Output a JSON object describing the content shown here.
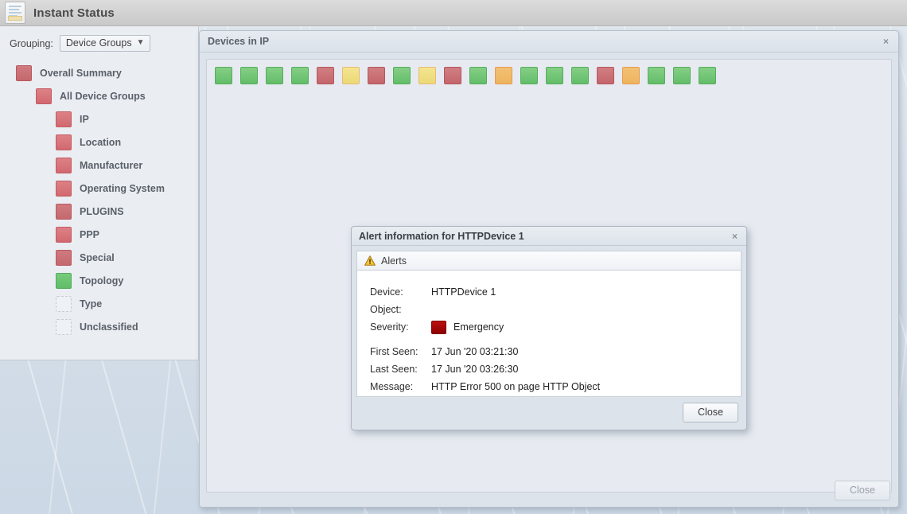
{
  "app": {
    "title": "Instant Status",
    "icon": "document-icon"
  },
  "sidebar": {
    "grouping_label": "Grouping:",
    "grouping_value": "Device Groups",
    "grouping_chevron": "⌄",
    "items": [
      {
        "label": "Overall Summary",
        "status": "red",
        "indent": 0
      },
      {
        "label": "All Device Groups",
        "status": "red2",
        "indent": 1
      },
      {
        "label": "IP",
        "status": "red2",
        "indent": 2
      },
      {
        "label": "Location",
        "status": "red2",
        "indent": 2
      },
      {
        "label": "Manufacturer",
        "status": "red2",
        "indent": 2
      },
      {
        "label": "Operating System",
        "status": "red2",
        "indent": 2
      },
      {
        "label": "PLUGINS",
        "status": "red",
        "indent": 2
      },
      {
        "label": "PPP",
        "status": "red2",
        "indent": 2
      },
      {
        "label": "Special",
        "status": "red",
        "indent": 2
      },
      {
        "label": "Topology",
        "status": "green",
        "indent": 2
      },
      {
        "label": "Type",
        "status": "empty",
        "indent": 2
      },
      {
        "label": "Unclassified",
        "status": "empty",
        "indent": 2
      }
    ]
  },
  "devices_window": {
    "title": "Devices in IP",
    "close_icon": "×",
    "close_button": "Close",
    "close_button_disabled": true,
    "tiles": [
      "green",
      "green",
      "green",
      "green",
      "red",
      "yellow",
      "red",
      "green",
      "yellow",
      "red",
      "green",
      "orange",
      "green",
      "green",
      "green",
      "red",
      "orange",
      "green",
      "green",
      "green"
    ]
  },
  "alert_dialog": {
    "title": "Alert information for HTTPDevice 1",
    "close_icon": "×",
    "tab_label": "Alerts",
    "tab_icon": "warning-triangle-icon",
    "fields": {
      "device_label": "Device:",
      "device_value": "HTTPDevice 1",
      "object_label": "Object:",
      "object_value": "",
      "severity_label": "Severity:",
      "severity_value": "Emergency",
      "first_seen_label": "First Seen:",
      "first_seen_value": "17 Jun '20 03:21:30",
      "last_seen_label": "Last Seen:",
      "last_seen_value": "17 Jun '20 03:26:30",
      "message_label": "Message:",
      "message_value": "HTTP Error 500 on page HTTP Object"
    },
    "close_button": "Close"
  },
  "colors": {
    "status_green": "#63bd69",
    "status_red": "#c4656b",
    "status_yellow": "#ecd975",
    "status_orange": "#edb45e",
    "severity_emergency": "#8e0000"
  }
}
